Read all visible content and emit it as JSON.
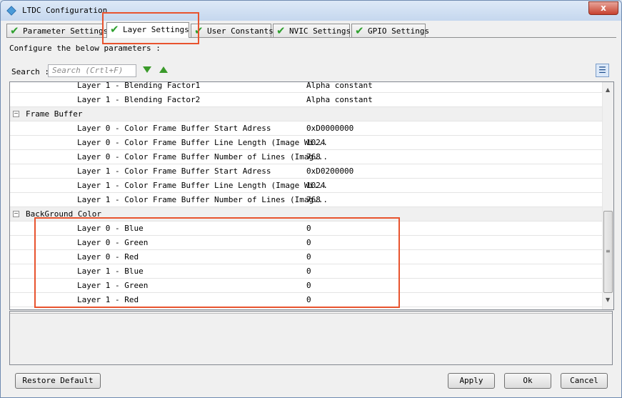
{
  "window": {
    "title": "LTDC Configuration",
    "close_label": "x"
  },
  "tabs": [
    {
      "label": "Parameter Settings",
      "active": false
    },
    {
      "label": "Layer Settings",
      "active": true
    },
    {
      "label": "User Constants",
      "active": false
    },
    {
      "label": "NVIC Settings",
      "active": false
    },
    {
      "label": "GPIO Settings",
      "active": false
    }
  ],
  "check_glyph": "✔",
  "configure_label": "Configure the below parameters :",
  "search": {
    "label": "Search :",
    "placeholder": "Search (Crtl+F)"
  },
  "rows": [
    {
      "type": "item",
      "name": "Layer 1 - Blending Factor1",
      "value": "Alpha constant"
    },
    {
      "type": "item",
      "name": "Layer 1 - Blending Factor2",
      "value": "Alpha constant"
    },
    {
      "type": "group",
      "name": "Frame Buffer"
    },
    {
      "type": "item",
      "name": "Layer 0 - Color Frame Buffer Start Adress",
      "value": "0xD0000000"
    },
    {
      "type": "item",
      "name": "Layer 0 - Color Frame Buffer Line Length (Image Wi...",
      "value": "1024"
    },
    {
      "type": "item",
      "name": "Layer 0 - Color Frame Buffer Number of Lines (Imag...",
      "value": "768"
    },
    {
      "type": "item",
      "name": "Layer 1 - Color Frame Buffer Start Adress",
      "value": "0xD0200000"
    },
    {
      "type": "item",
      "name": "Layer 1 - Color Frame Buffer Line Length (Image Wi...",
      "value": "1024"
    },
    {
      "type": "item",
      "name": "Layer 1 - Color Frame Buffer Number of Lines (Imag...",
      "value": "768"
    },
    {
      "type": "group",
      "name": "BackGround Color"
    },
    {
      "type": "item",
      "name": "Layer 0 - Blue",
      "value": "0"
    },
    {
      "type": "item",
      "name": "Layer 0 - Green",
      "value": "0"
    },
    {
      "type": "item",
      "name": "Layer 0 - Red",
      "value": "0"
    },
    {
      "type": "item",
      "name": "Layer 1 - Blue",
      "value": "0"
    },
    {
      "type": "item",
      "name": "Layer 1 - Green",
      "value": "0"
    },
    {
      "type": "item",
      "name": "Layer 1 - Red",
      "value": "0"
    }
  ],
  "group_toggle": "−",
  "buttons": {
    "restore_default": "Restore Default",
    "apply": "Apply",
    "ok": "Ok",
    "cancel": "Cancel"
  },
  "icons": {
    "down_arrow": "arrow-down-green",
    "up_arrow": "arrow-up-green",
    "list_view": "list-view-icon"
  },
  "colors": {
    "highlight": "#e8532e",
    "check": "#2ea02e",
    "arrows": "#3a9a2a"
  }
}
